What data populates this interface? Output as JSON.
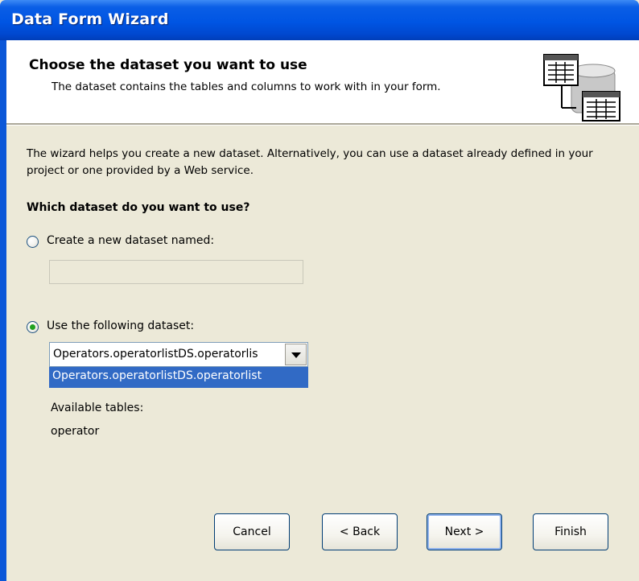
{
  "window": {
    "title": "Data Form Wizard"
  },
  "header": {
    "title": "Choose the dataset you want to use",
    "subtitle": "The dataset contains the tables and columns to work with in your form."
  },
  "content": {
    "intro": "The wizard helps you create a new dataset. Alternatively, you can use a dataset already defined in your project or one provided by a Web service.",
    "question": "Which dataset do you want to use?",
    "option_new": {
      "label": "Create a new dataset named:",
      "selected": false,
      "value": ""
    },
    "option_existing": {
      "label": "Use the following dataset:",
      "selected": true
    },
    "dataset_combo": {
      "value": "Operators.operatorlistDS.operatorlis",
      "dropdown_item": "Operators.operatorlistDS.operatorlist"
    },
    "available_tables_label": "Available tables:",
    "tables": [
      "operator"
    ]
  },
  "footer": {
    "cancel": "Cancel",
    "back": "< Back",
    "next": "Next >",
    "finish": "Finish"
  },
  "colors": {
    "title_bar": "#0055e3",
    "selection": "#316ac5",
    "dialog_bg": "#ece9d8"
  }
}
